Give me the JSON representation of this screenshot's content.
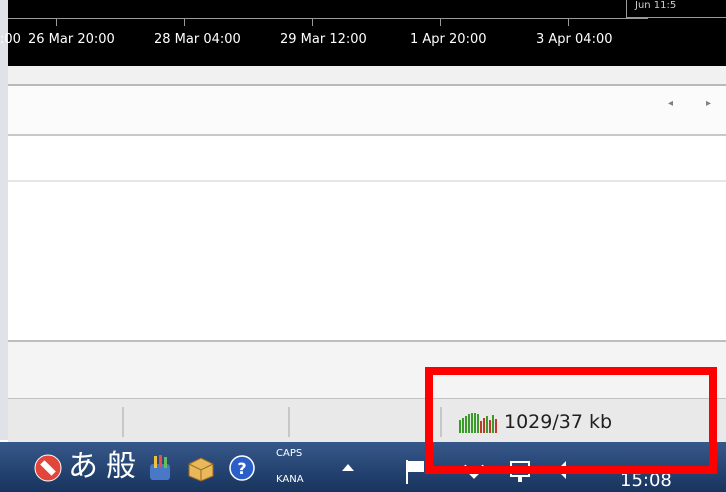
{
  "timeline": {
    "labels": [
      ":00",
      "26 Mar 20:00",
      "28 Mar 04:00",
      "29 Mar 12:00",
      "1 Apr 20:00",
      "3 Apr 04:00"
    ],
    "corner_text": "Jun 11:5"
  },
  "toolbar": {
    "scroll_left": "◂",
    "scroll_right": "▸"
  },
  "statusbar": {
    "network_text": "1029/37 kb"
  },
  "taskbar": {
    "ime_hiragana": "あ",
    "ime_mode": "般",
    "caps": "CAPS",
    "kana": "KANA",
    "clock": "15:08"
  },
  "icons": [
    "no-entry-icon",
    "ime-hiragana-icon",
    "ime-mode-icon",
    "pencil-cup-icon",
    "box-icon",
    "help-icon",
    "network-activity-icon",
    "show-hidden-icons-icon",
    "flag-icon",
    "network-icon",
    "display-icon",
    "volume-icon"
  ],
  "colors": {
    "highlight": "#ff0000",
    "taskbar": "#2a4a7a",
    "timeline_bg": "#000000"
  }
}
